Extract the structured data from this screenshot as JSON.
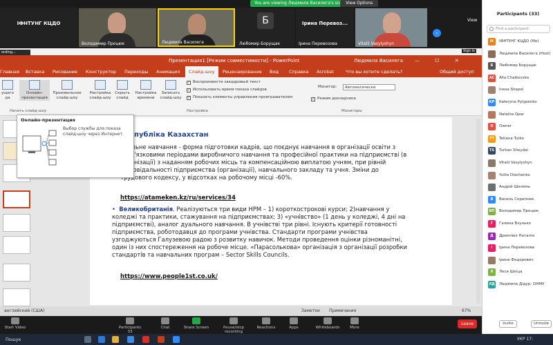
{
  "banner": {
    "viewing": "You are viewing Людмила Василега's screen",
    "view_options": "View Options"
  },
  "video_strip": {
    "tiles": [
      {
        "name": "ІФНТУНГ КЦДО",
        "big": "ІФНТУНГ КЦДО"
      },
      {
        "name": "Володимир Процюк"
      },
      {
        "name": "Людмила Василега"
      },
      {
        "name": "Любомир Борущак",
        "initial": "Б"
      },
      {
        "name": "Ірина Перевозова",
        "big": "Ірина Перевоз..."
      },
      {
        "name": "Vitalii Vasylyshyn"
      }
    ],
    "next_icon": "chevron-right-icon",
    "view_label": "View"
  },
  "share": {
    "recording": "ording...",
    "sign_in": "Sign in"
  },
  "powerpoint": {
    "title": "Презентация1 [Режим совместимости] - PowerPoint",
    "user": "Людмила Василега",
    "window_controls": "— ☐ ✕",
    "tabs": [
      "Главная",
      "Вставка",
      "Рисование",
      "Конструктор",
      "Переходы",
      "Анимация",
      "Слайд-шоу",
      "Рецензирование",
      "Вид",
      "Справка",
      "Acrobat",
      "Что вы хотите сделать?",
      "Общий доступ"
    ],
    "selected_tab": "Слайд-шоу",
    "ribbon": {
      "b_current": "ущего\nда",
      "b_online": "Онлайн-\nпрезентация",
      "b_custom": "Произвольное\nслайд-шоу",
      "b_setup": "Настройка\nслайд-шоу",
      "b_hide": "Скрыть\nслайд",
      "b_timing": "Настройка\nвремени",
      "b_record": "Записать\nслайд-шоу",
      "chk_narration": "Воспроизвести закадровый текст",
      "chk_timing": "Использовать время показа слайдов",
      "chk_controls": "Показать элементы управления проигрывателем",
      "monitor_label": "Монитор:",
      "monitor_value": "Автоматически",
      "chk_presenter": "Режим докладчика",
      "grp_start": "Начать слайд-шоу",
      "grp_setup": "Настройка",
      "grp_monitors": "Мониторы"
    },
    "tooltip": {
      "title": "Онлайн-презентация",
      "desc": "Выбор службы для показа слайд-шоу через Интернет."
    },
    "slide": {
      "title": "Республіка Казахстан",
      "para1": "Дуальне навчання - форма підготовки кадрів, що поєднує навчання в організації освіти з обов'язковими періодами виробничого навчання та професійної практики на підприємстві (в організації) з наданням робочих місць та компенсаційною виплатою учням, при рівній відповідальності підприємства (організації), навчального закладу та учня. Зміни до Трудового кодексу, у відсотках на робочому місці -60%.",
      "link1": "https://atameken.kz/ru/services/34",
      "bullet2_head": "Великобританія",
      "para2": ". Реалізуються три види НРМ – 1) короткострокові курси; 2)навчання у коледжі та практики, стажування на підприємствах; 3) «учнівство» (1 день у коледжі, 4 дні на підприємстві), аналог дуального навчання. В учнівстві три рівні. Існують критерії готовності підприємства, роботодавця до програми учнівства. Стандарти програми учнівства узгоджуються Галузевою радою з розвитку навичок. Методи проведення оцінки різноманітні, один із них спостереження на робоче місце. «Парасолькова» організація з організації розробки стандартів та навчальних програм – Sector Skills Councils.",
      "link2": "https://www.people1st.co.uk/"
    },
    "status": {
      "lang": "английский (США)",
      "notes": "Заметки",
      "comments": "Примечания",
      "zoom": "67%"
    }
  },
  "toolbar": {
    "items": [
      {
        "label": "Start Video"
      },
      {
        "label": "Participants",
        "badge": "33"
      },
      {
        "label": "Chat"
      },
      {
        "label": "Share Screen"
      },
      {
        "label": "Pause/stop recording"
      },
      {
        "label": "Reactions"
      },
      {
        "label": "Apps"
      },
      {
        "label": "Whiteboards"
      },
      {
        "label": "More"
      }
    ],
    "leave": "Leave"
  },
  "taskbar": {
    "search": "Пошук",
    "tray": "УКР",
    "time": "17:"
  },
  "participants": {
    "title": "Participants (33)",
    "find_placeholder": "Find a participant",
    "list": [
      {
        "initials": "ІК",
        "name": "ІФНТУНГ КЦДО (Me)",
        "color": "#e67e22"
      },
      {
        "initials": "",
        "name": "Людмила Василега (Host)",
        "color": "#8e6a5a"
      },
      {
        "initials": "Б",
        "name": "Любомир Борущак",
        "color": "#555555"
      },
      {
        "initials": "AC",
        "name": "Alla Chaikovska",
        "color": "#e74c3c"
      },
      {
        "initials": "",
        "name": "Inesa Shepel",
        "color": "#a08070"
      },
      {
        "initials": "KP",
        "name": "Kateryna Pylypenko",
        "color": "#2d8cff"
      },
      {
        "initials": "",
        "name": "Nataliia Opar",
        "color": "#b07a5e"
      },
      {
        "initials": "O",
        "name": "Owner",
        "color": "#e74c3c"
      },
      {
        "initials": "TT",
        "name": "Tetiana Tutko",
        "color": "#f39c12"
      },
      {
        "initials": "TS",
        "name": "Turkan Sheydai",
        "color": "#34495e"
      },
      {
        "initials": "",
        "name": "Vitalii Vasylyshyn",
        "color": "#8a7868"
      },
      {
        "initials": "",
        "name": "Yuliia Diachenko",
        "color": "#a6826c"
      },
      {
        "initials": "",
        "name": "Андрій Шелемь",
        "color": "#6e6e6e"
      },
      {
        "initials": "В",
        "name": "Василь Скрипник",
        "color": "#2d8cff"
      },
      {
        "initials": "ВП",
        "name": "Володимир Процюк",
        "color": "#7cb342"
      },
      {
        "initials": "Г",
        "name": "Галина Взунько",
        "color": "#e91e63"
      },
      {
        "initials": "Д",
        "name": "Дремлюх Наталія",
        "color": "#9c27b0"
      },
      {
        "initials": "І",
        "name": "Ірина Перевозова",
        "color": "#e91e63"
      },
      {
        "initials": "",
        "name": "Ірина Федорович",
        "color": "#9a7a66"
      },
      {
        "initials": "Л",
        "name": "Леся Шкіца",
        "color": "#7cb342"
      },
      {
        "initials": "ЛД",
        "name": "Людмила Дідур; ОНМУ",
        "color": "#26a69a"
      }
    ],
    "invite": "Invite",
    "unmute": "Unmute"
  }
}
